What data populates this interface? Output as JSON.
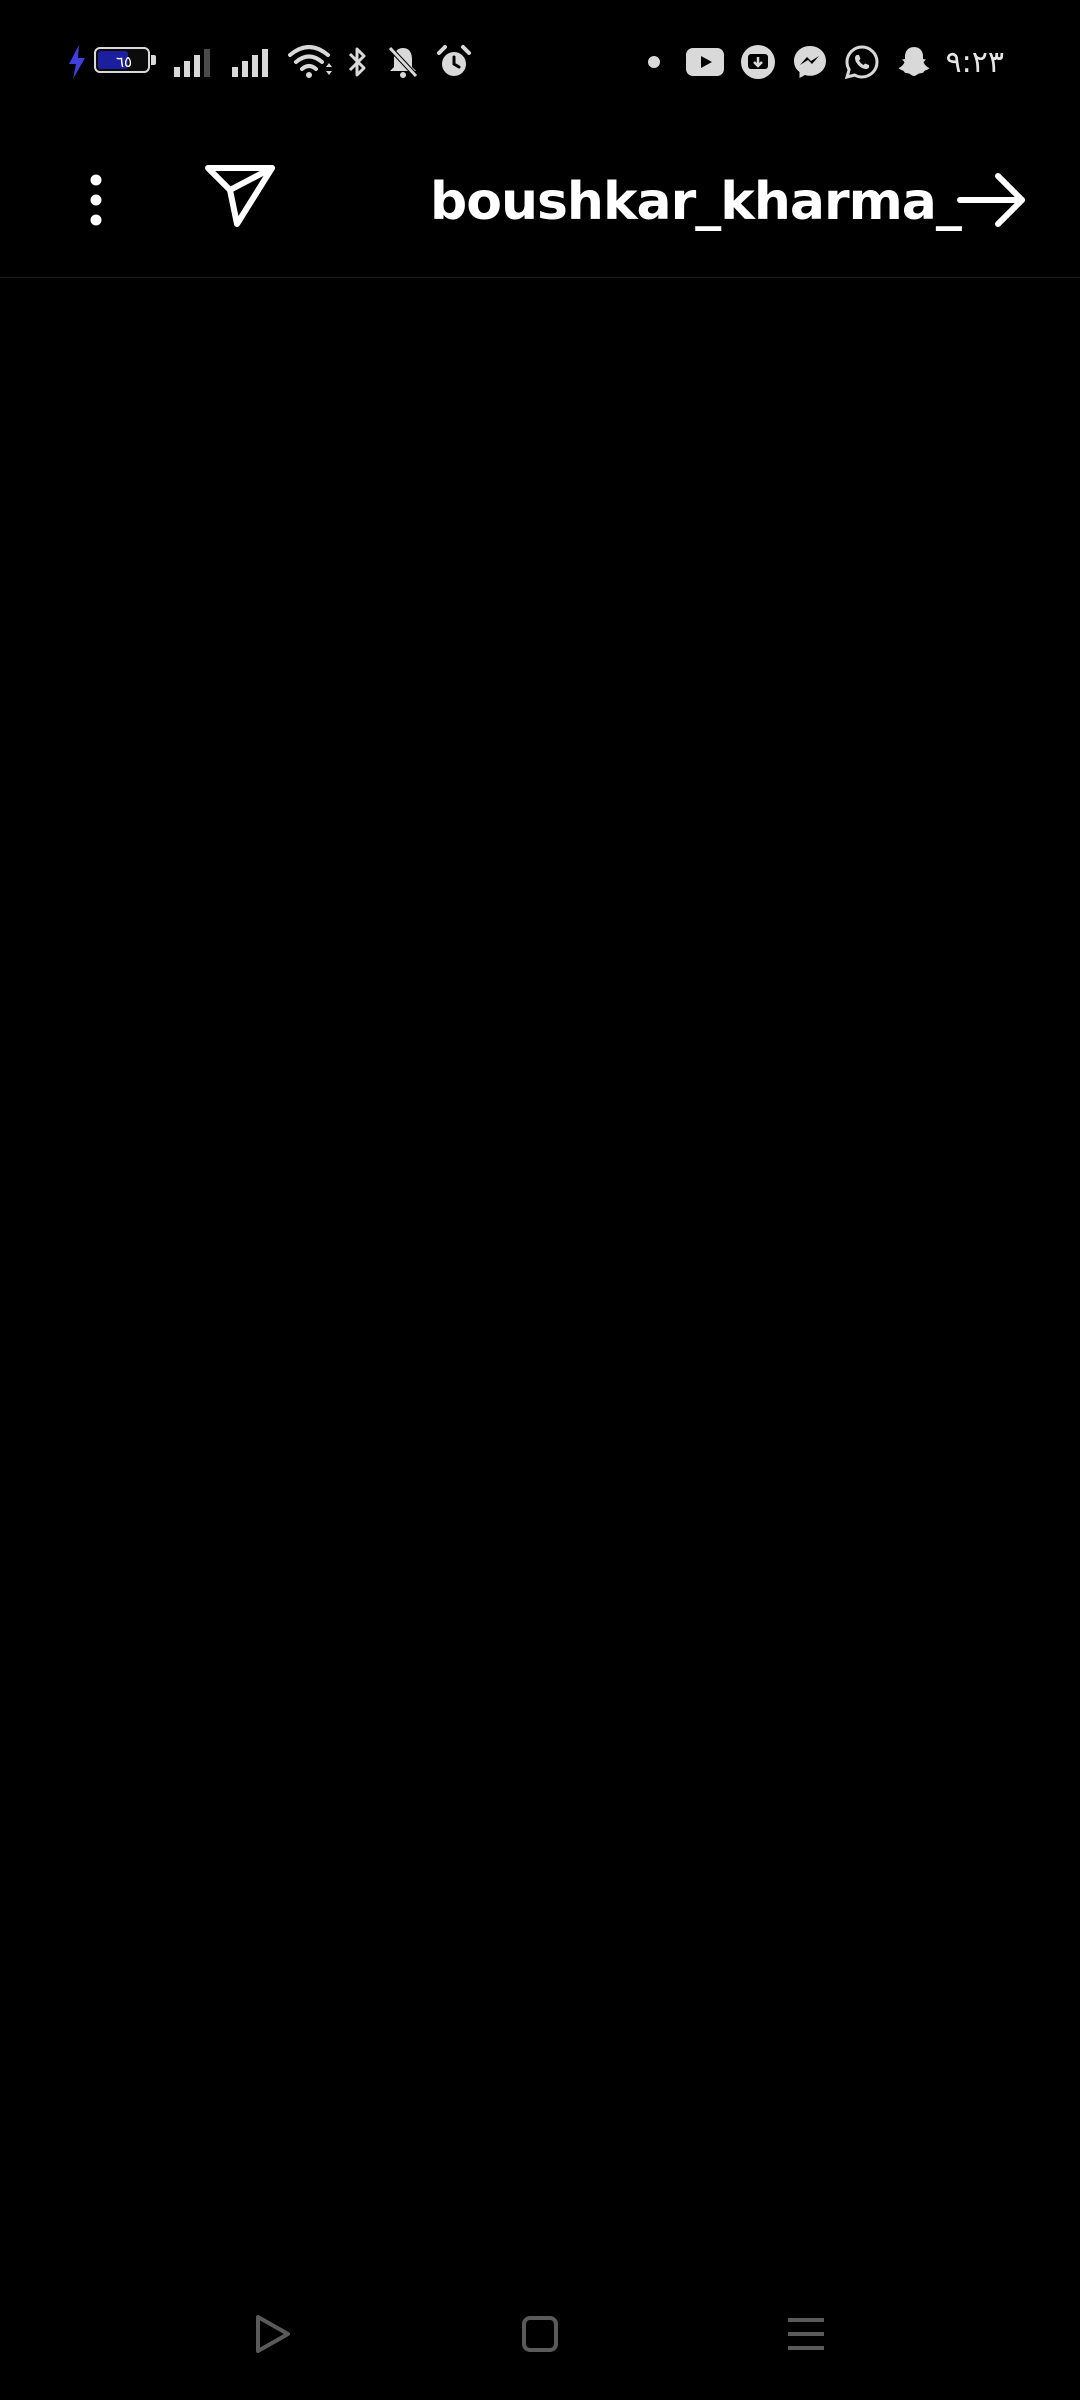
{
  "status_bar": {
    "time": "٩:٢٣",
    "battery_level": "٦٥",
    "battery_percent": 65,
    "charging_bolt_color": "#3f3fe0",
    "left_icons": [
      "charging-bolt-icon",
      "battery-icon",
      "signal-strength-icon",
      "signal-strength-icon",
      "wifi-icon",
      "bluetooth-icon",
      "notifications-muted-icon",
      "alarm-clock-icon"
    ],
    "right_icons": [
      "notification-dot-icon",
      "youtube-icon",
      "download-app-icon",
      "messenger-icon",
      "whatsapp-icon",
      "snapchat-icon"
    ]
  },
  "header": {
    "username": "boushkar_kharma_",
    "icons": [
      "more-options-icon",
      "send-icon",
      "arrow-right-icon"
    ]
  },
  "nav_bar": {
    "icons": [
      "back-triangle-icon",
      "home-square-icon",
      "recents-menu-icon"
    ]
  },
  "colors": {
    "background": "#000000",
    "foreground": "#ffffff",
    "status_icons": "#d9d9d9",
    "nav_icons": "#5a5a5a"
  }
}
